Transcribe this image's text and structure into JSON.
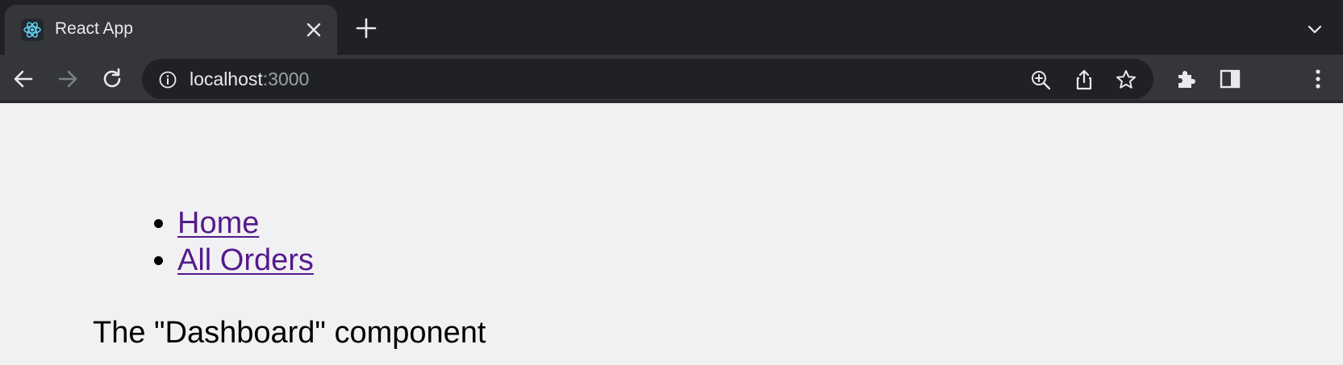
{
  "browser": {
    "tab": {
      "title": "React App",
      "favicon": "react-logo-icon"
    },
    "toolbar": {
      "back_icon": "back-arrow-icon",
      "forward_icon": "forward-arrow-icon",
      "reload_icon": "reload-icon"
    },
    "omnibox": {
      "host": "localhost",
      "port": ":3000",
      "info_icon": "info-icon",
      "actions": [
        "zoom-icon",
        "share-icon",
        "bookmark-star-icon"
      ]
    },
    "extensions_icon": "puzzle-icon",
    "side_panel_icon": "side-panel-icon",
    "menu_icon": "kebab-menu-icon"
  },
  "page": {
    "nav": [
      {
        "label": "Home"
      },
      {
        "label": "All Orders"
      }
    ],
    "component_text": "The \"Dashboard\" component"
  },
  "colors": {
    "tabstrip": "#202124",
    "toolbar": "#35363a",
    "page_bg": "#f1f1f3",
    "link_visited": "#551a8b"
  }
}
